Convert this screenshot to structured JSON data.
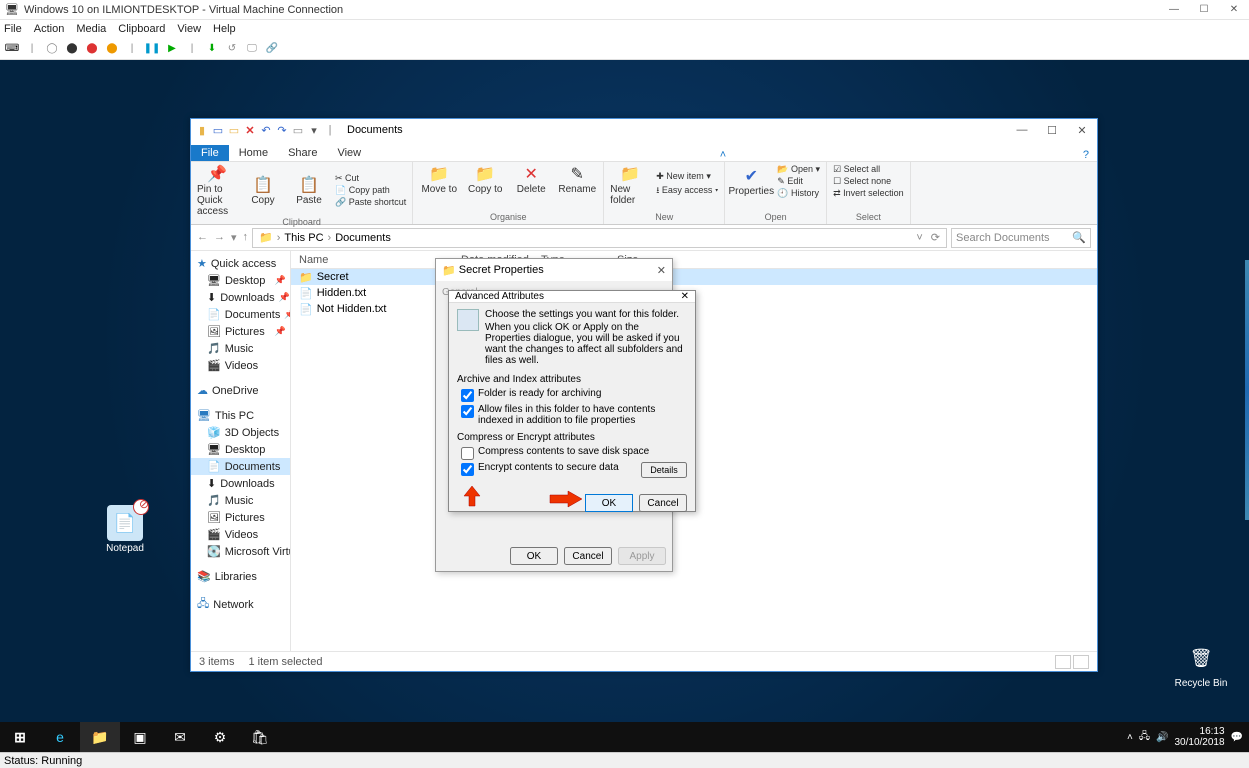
{
  "host": {
    "title": "Windows 10 on ILMIONTDESKTOP - Virtual Machine Connection",
    "menus": [
      "File",
      "Action",
      "Media",
      "Clipboard",
      "View",
      "Help"
    ],
    "status": "Status: Running"
  },
  "vm": {
    "desktop_icons": {
      "notepad": "Notepad",
      "recycle": "Recycle Bin"
    },
    "taskbar": {
      "time": "16:13",
      "date": "30/10/2018"
    }
  },
  "explorer": {
    "title": "Documents",
    "tabs": [
      "File",
      "Home",
      "Share",
      "View"
    ],
    "active_tab": "File",
    "ribbon": {
      "clipboard": {
        "pin": "Pin to Quick access",
        "copy": "Copy",
        "paste": "Paste",
        "cut": "Cut",
        "copypath": "Copy path",
        "pasteshortcut": "Paste shortcut",
        "label": "Clipboard"
      },
      "organise": {
        "move": "Move to",
        "copyto": "Copy to",
        "delete": "Delete",
        "rename": "Rename",
        "label": "Organise"
      },
      "new": {
        "newfolder": "New folder",
        "newitem": "New item",
        "easy": "Easy access",
        "label": "New"
      },
      "open": {
        "properties": "Properties",
        "open": "Open",
        "edit": "Edit",
        "history": "History",
        "label": "Open"
      },
      "select": {
        "all": "Select all",
        "none": "Select none",
        "invert": "Invert selection",
        "label": "Select"
      }
    },
    "breadcrumb": [
      "This PC",
      "Documents"
    ],
    "search_placeholder": "Search Documents",
    "columns": [
      "Name",
      "Date modified",
      "Type",
      "Size"
    ],
    "files": [
      {
        "name": "Secret",
        "selected": true,
        "icon": "📁"
      },
      {
        "name": "Hidden.txt",
        "selected": false,
        "icon": "📄"
      },
      {
        "name": "Not Hidden.txt",
        "selected": false,
        "icon": "📄"
      }
    ],
    "nav": {
      "quick": {
        "label": "Quick access",
        "items": [
          "Desktop",
          "Downloads",
          "Documents",
          "Pictures",
          "Music",
          "Videos"
        ]
      },
      "onedrive": "OneDrive",
      "thispc": {
        "label": "This PC",
        "items": [
          "3D Objects",
          "Desktop",
          "Documents",
          "Downloads",
          "Music",
          "Pictures",
          "Videos",
          "Microsoft Virtual Di"
        ]
      },
      "libraries": "Libraries",
      "network": "Network"
    },
    "status": {
      "count": "3 items",
      "selected": "1 item selected"
    }
  },
  "props": {
    "title": "Secret Properties",
    "tabs_hint": "General",
    "ok": "OK",
    "cancel": "Cancel",
    "apply": "Apply"
  },
  "adv": {
    "title": "Advanced Attributes",
    "intro1": "Choose the settings you want for this folder.",
    "intro2": "When you click OK or Apply on the Properties dialogue, you will be asked if you want the changes to affect all subfolders and files as well.",
    "sec1": "Archive and Index attributes",
    "chk1": {
      "label": "Folder is ready for archiving",
      "checked": true
    },
    "chk2": {
      "label": "Allow files in this folder to have contents indexed in addition to file properties",
      "checked": true
    },
    "sec2": "Compress or Encrypt attributes",
    "chk3": {
      "label": "Compress contents to save disk space",
      "checked": false
    },
    "chk4": {
      "label": "Encrypt contents to secure data",
      "checked": true
    },
    "details": "Details",
    "ok": "OK",
    "cancel": "Cancel"
  }
}
